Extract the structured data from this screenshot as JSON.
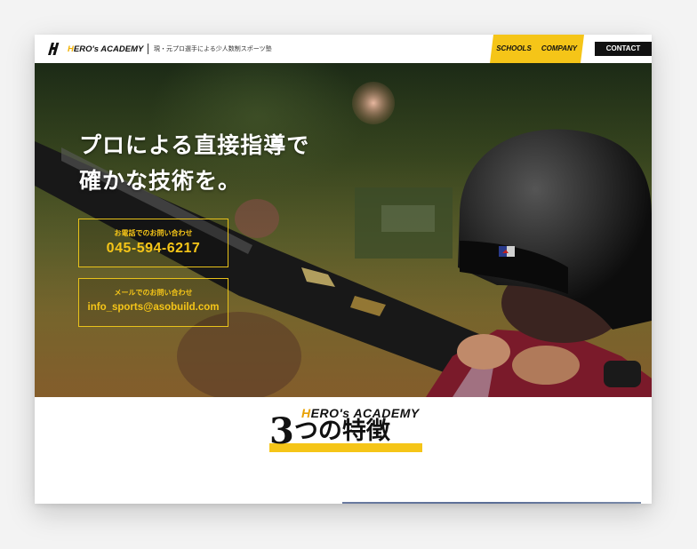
{
  "header": {
    "brand_prefix": "H",
    "brand_rest": "ERO's ACADEMY",
    "tagline": "現・元プロ選手による少人数制スポーツ塾",
    "nav": {
      "schools": "SCHOOLS",
      "company": "COMPANY",
      "contact": "CONTACT"
    }
  },
  "hero": {
    "headline_line1": "プロによる直接指導で",
    "headline_line2": "確かな技術を。",
    "phone_label": "お電話でのお問い合わせ",
    "phone_number": "045-594-6217",
    "mail_label": "メールでのお問い合わせ",
    "mail_address": "info_sports@asobuild.com"
  },
  "features": {
    "brand_prefix": "H",
    "brand_rest": "ERO's ACADEMY",
    "title_number": "3",
    "title_text": "つの特徴"
  },
  "colors": {
    "accent": "#f5c518",
    "dark": "#111111",
    "white": "#ffffff"
  },
  "icons": {
    "logo": "hero-academy-logo-icon"
  }
}
